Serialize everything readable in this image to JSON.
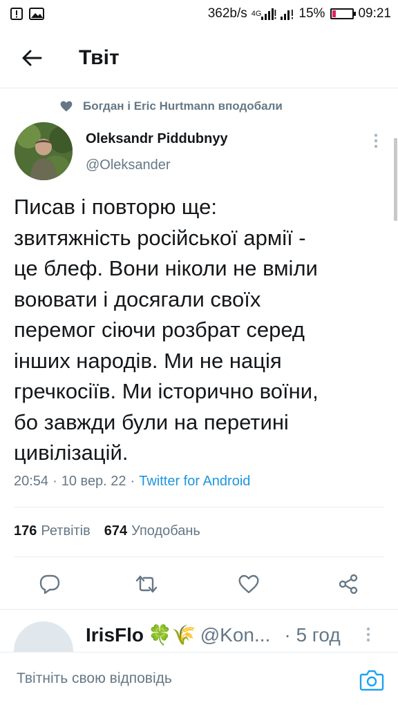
{
  "status_bar": {
    "speed": "362b/s",
    "network": "4G",
    "battery_pct": "15%",
    "battery_level": 0.15,
    "time": "09:21"
  },
  "header": {
    "title": "Твіт"
  },
  "tweet": {
    "social_context": "Богдан і Eric Hurtmann вподобали",
    "author_name": "Oleksandr Piddubnyy",
    "author_handle": "@Oleksander",
    "text": "Писав і повторю ще:\nзвитяжність російської армії -\nце блеф. Вони ніколи не вміли\nвоювати і досягали своїх\nперемог сіючи розбрат серед\nінших народів. Ми не нація\nгречкосіїв. Ми історично воїни,\nбо завжди були на перетині\nцивілізацій.",
    "time": "20:54",
    "date": "10 вер. 22",
    "source": "Twitter for Android",
    "retweets_count": "176",
    "retweets_label": "Ретвітів",
    "likes_count": "674",
    "likes_label": "Уподобань"
  },
  "reply_preview": {
    "name": "IrisFlo",
    "emoji": "🍀🌾",
    "handle": "@Kon...",
    "time": "· 5 год"
  },
  "compose": {
    "placeholder": "Твітніть свою відповідь"
  },
  "icons": {
    "back": "arrow-left-icon",
    "reply": "comment-icon",
    "retweet": "retweet-icon",
    "like": "heart-icon",
    "share": "share-icon",
    "camera": "camera-icon",
    "more": "more-vertical-icon"
  },
  "colors": {
    "text_primary": "#14171a",
    "text_secondary": "#657786",
    "link": "#1b95e0",
    "battery_low": "#e0245e"
  }
}
